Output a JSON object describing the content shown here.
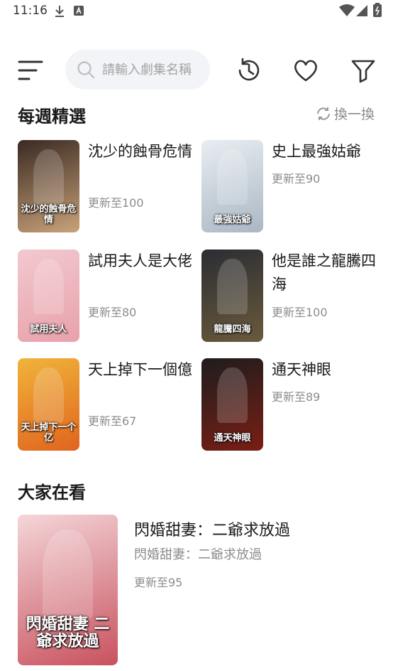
{
  "status_bar": {
    "time": "11:16"
  },
  "toolbar": {
    "search_placeholder": "請輸入劇集名稱"
  },
  "weekly": {
    "title": "每週精選",
    "refresh_label": "換一換",
    "items": [
      {
        "title": "沈少的蝕骨危情",
        "update": "更新至100",
        "cover_colors": [
          "#3a2a22",
          "#c9a27a"
        ],
        "cover_text": "沈少的蝕骨危情"
      },
      {
        "title": "史上最強姑爺",
        "update": "更新至90",
        "cover_colors": [
          "#e8eef2",
          "#aab7c4"
        ],
        "cover_text": "最強姑爺"
      },
      {
        "title": "試用夫人是大佬",
        "update": "更新至80",
        "cover_colors": [
          "#f2c9cf",
          "#e8a1ab"
        ],
        "cover_text": "試用夫人"
      },
      {
        "title": "他是誰之龍騰四海",
        "update": "更新至100",
        "cover_colors": [
          "#2a2d33",
          "#6b5a3c"
        ],
        "cover_text": "龍騰四海"
      },
      {
        "title": "天上掉下一個億",
        "update": "更新至67",
        "cover_colors": [
          "#f0b43a",
          "#e0641e"
        ],
        "cover_text": "天上掉下一个亿"
      },
      {
        "title": "通天神眼",
        "update": "更新至89",
        "cover_colors": [
          "#1d1d1d",
          "#7a1e14"
        ],
        "cover_text": "通天神眼"
      }
    ]
  },
  "popular": {
    "title": "大家在看",
    "item": {
      "title": "閃婚甜妻：二爺求放過",
      "subtitle": "閃婚甜妻：二爺求放過",
      "update": "更新至95",
      "cover_colors": [
        "#f4d6d9",
        "#c8525e"
      ],
      "cover_text": "閃婚甜妻 二爺求放過"
    }
  }
}
